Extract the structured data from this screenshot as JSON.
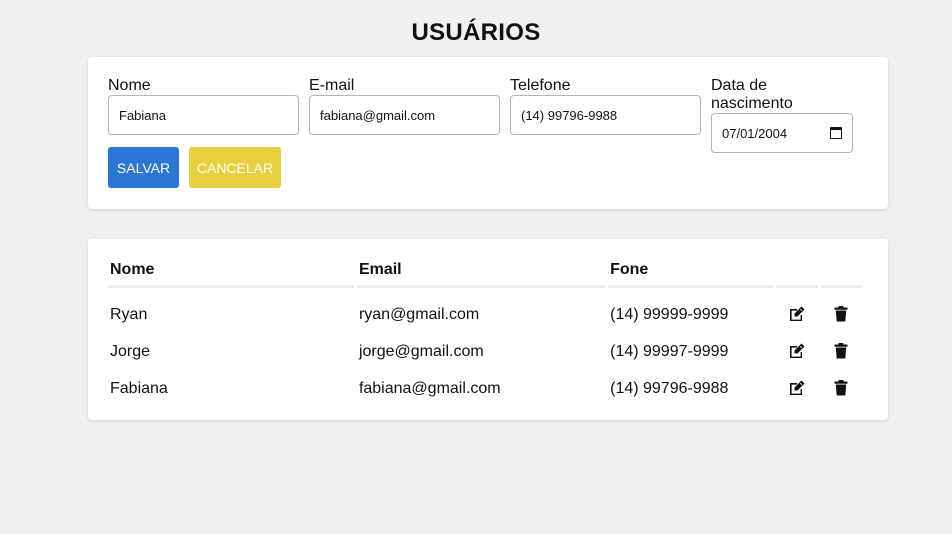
{
  "page": {
    "title": "USUÁRIOS"
  },
  "form": {
    "nome": {
      "label": "Nome",
      "value": "Fabiana"
    },
    "email": {
      "label": "E-mail",
      "value": "fabiana@gmail.com"
    },
    "telefone": {
      "label": "Telefone",
      "value": "(14) 99796-9988"
    },
    "nascimento": {
      "label": "Data de nascimento",
      "value": "07/01/2004"
    },
    "save_label": "SALVAR",
    "cancel_label": "CANCELAR"
  },
  "table": {
    "headers": [
      "Nome",
      "Email",
      "Fone",
      "",
      ""
    ],
    "rows": [
      {
        "nome": "Ryan",
        "email": "ryan@gmail.com",
        "fone": "(14) 99999-9999"
      },
      {
        "nome": "Jorge",
        "email": "jorge@gmail.com",
        "fone": "(14) 99997-9999"
      },
      {
        "nome": "Fabiana",
        "email": "fabiana@gmail.com",
        "fone": "(14) 99796-9988"
      }
    ],
    "row_actions": [
      "edit-icon",
      "trash-icon"
    ]
  },
  "colors": {
    "primary": "#2c76d6",
    "warning": "#e8cf3e",
    "background": "#f0f0f0"
  }
}
